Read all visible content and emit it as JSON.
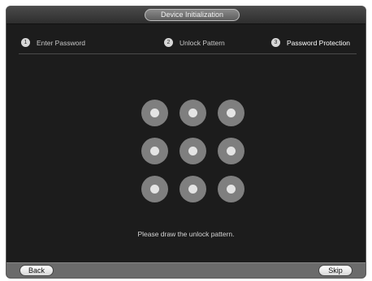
{
  "window": {
    "title": "Device Initialization"
  },
  "steps": [
    {
      "number": "1",
      "label": "Enter Password"
    },
    {
      "number": "2",
      "label": "Unlock Pattern"
    },
    {
      "number": "3",
      "label": "Password Protection"
    }
  ],
  "active_step_label": "Password Protection",
  "pattern": {
    "rows": 3,
    "cols": 3,
    "hint": "Please draw the unlock pattern."
  },
  "buttons": {
    "back": "Back",
    "skip": "Skip"
  },
  "colors": {
    "background": "#1c1c1c",
    "dot_outer": "#7f7f7f",
    "dot_inner": "#e4e4e4"
  }
}
